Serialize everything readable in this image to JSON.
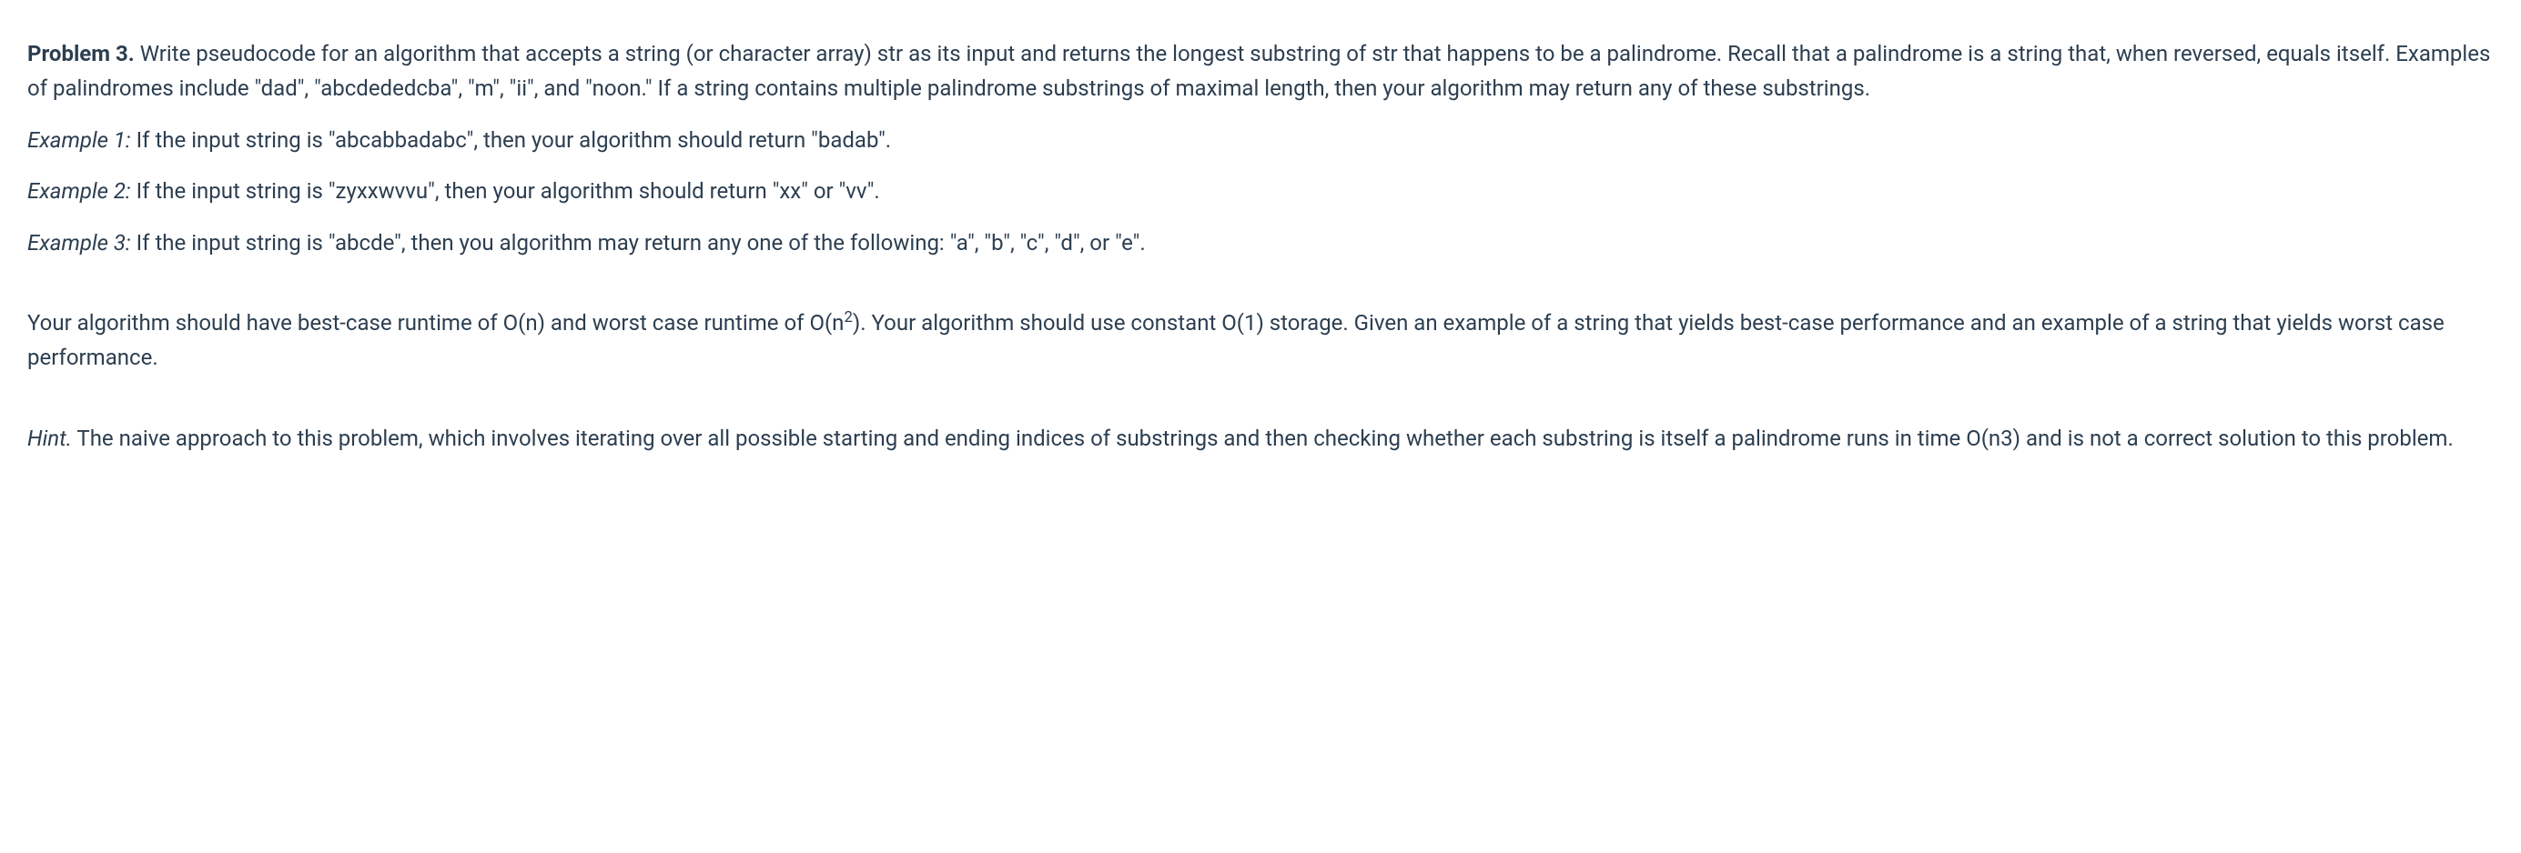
{
  "problem": {
    "label": "Problem 3.",
    "statement": " Write pseudocode for an algorithm that accepts a string (or character array) str as its input and returns the longest substring of str that happens to be a palindrome. Recall that a palindrome is a string that, when reversed, equals itself. Examples of palindromes include \"dad\", \"abcdededcba\", \"m\", \"ii\", and \"noon.\" If a string contains multiple palindrome substrings of maximal length, then your algorithm may return any of these substrings."
  },
  "examples": [
    {
      "label": "Example 1:",
      "text": " If the input string is \"abcabbadabc\", then your algorithm should return \"badab\"."
    },
    {
      "label": "Example 2:",
      "text": " If the input string is \"zyxxwvvu\", then your algorithm should return \"xx\" or \"vv\"."
    },
    {
      "label": "Example 3:",
      "text": " If the input string is \"abcde\", then you algorithm may return any one of the following: \"a\", \"b\", \"c\", \"d\", or \"e\"."
    }
  ],
  "requirements": {
    "part1": "Your algorithm should have best-case runtime of O(n) and worst case runtime of O(n",
    "sup1": "2",
    "part2": "). Your algorithm should use constant O(1) storage. Given an example of a string that yields best-case performance and an example of a string that yields worst case performance."
  },
  "hint": {
    "label": "Hint.",
    "text": " The naive approach to this problem, which involves iterating over all possible starting and ending indices of substrings and then checking whether each substring is itself a palindrome runs in time O(n3) and is not a correct solution to this problem."
  }
}
